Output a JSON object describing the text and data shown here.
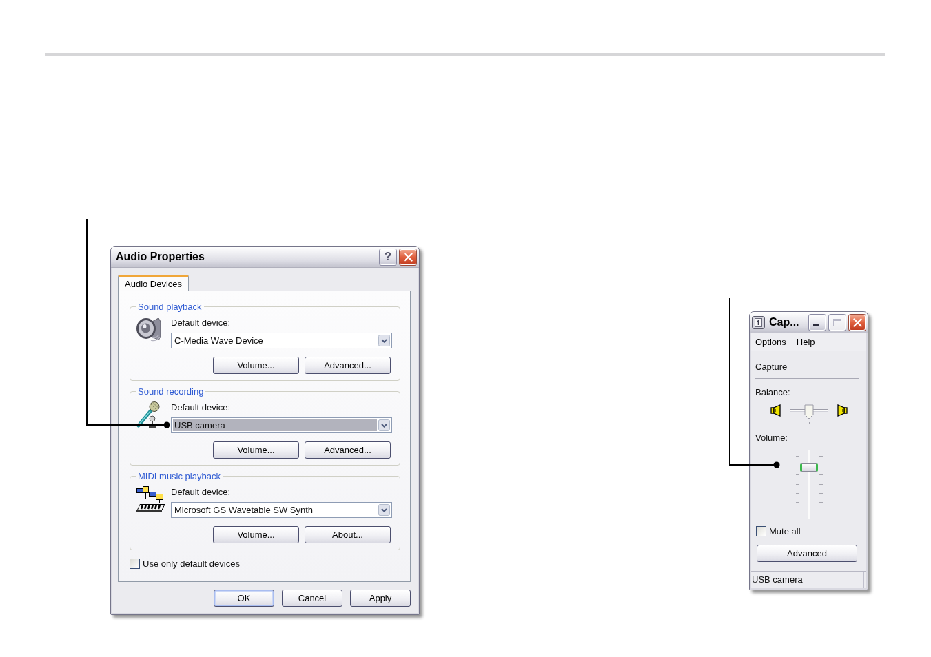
{
  "audio_properties": {
    "title": "Audio Properties",
    "title_buttons": [
      {
        "kind": "help",
        "label": "?",
        "disabled": false
      },
      {
        "kind": "close",
        "disabled": false
      }
    ],
    "tabs": [
      {
        "label": "Audio Devices",
        "selected": true
      }
    ],
    "groups": [
      {
        "kind": "playback",
        "title": "Sound playback",
        "field_label": "Default device:",
        "device": {
          "value": "C-Media Wave Device",
          "highlighted": false
        },
        "buttons": [
          "Volume...",
          "Advanced..."
        ]
      },
      {
        "kind": "recording",
        "title": "Sound recording",
        "field_label": "Default device:",
        "device": {
          "value": "USB camera",
          "highlighted": true
        },
        "buttons": [
          "Volume...",
          "Advanced..."
        ]
      },
      {
        "kind": "midi",
        "title": "MIDI music playback",
        "field_label": "Default device:",
        "device": {
          "value": "Microsoft GS Wavetable SW Synth",
          "highlighted": false
        },
        "buttons": [
          "Volume...",
          "About..."
        ]
      }
    ],
    "use_only_default_devices": {
      "label": "Use only default devices",
      "checked": false
    },
    "buttons": [
      {
        "label": "OK",
        "default": true
      },
      {
        "label": "Cancel",
        "default": false
      },
      {
        "label": "Apply",
        "default": false
      }
    ]
  },
  "capture_window": {
    "title": "Cap...",
    "title_buttons": [
      {
        "kind": "minimize",
        "disabled": false
      },
      {
        "kind": "maximize",
        "disabled": true
      },
      {
        "kind": "close",
        "disabled": false
      }
    ],
    "menu": [
      "Options",
      "Help"
    ],
    "heading": "Capture",
    "balance": {
      "label": "Balance:",
      "level": 0.5
    },
    "volume": {
      "label": "Volume:",
      "level": 0.75
    },
    "mute_all": {
      "label": "Mute all",
      "checked": false
    },
    "button": "Advanced",
    "status_bar": "USB camera"
  }
}
